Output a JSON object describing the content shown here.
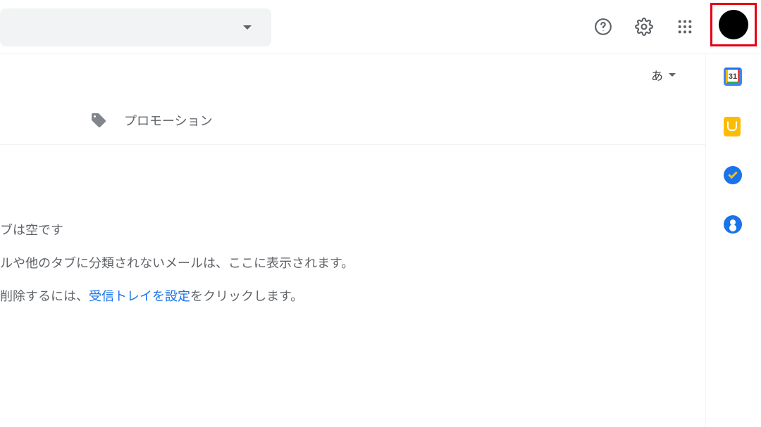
{
  "toolbar": {
    "input_type_label": "あ"
  },
  "tabs": {
    "promotions_label": "プロモーション"
  },
  "sidepanel": {
    "calendar_day": "31"
  },
  "empty_state": {
    "line1": "ブは空です",
    "line2": "ルや他のタブに分類されないメールは、ここに表示されます。",
    "line3a": "削除するには、",
    "line3_link": "受信トレイを設定",
    "line3b": "をクリックします。"
  }
}
